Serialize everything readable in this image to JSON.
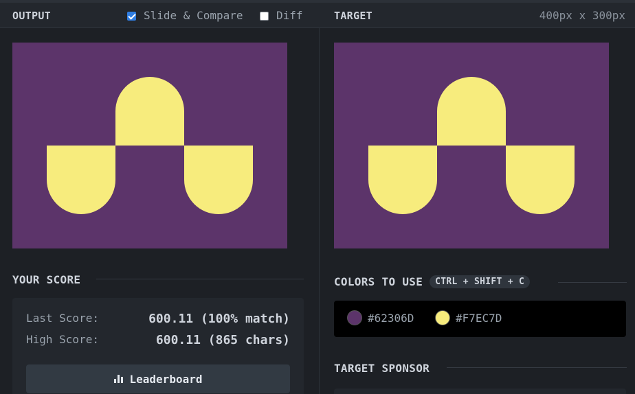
{
  "header": {
    "output_label": "OUTPUT",
    "slide_compare_label": "Slide & Compare",
    "slide_compare_checked": true,
    "diff_label": "Diff",
    "diff_checked": false,
    "target_label": "TARGET",
    "dimensions": "400px x 300px"
  },
  "score": {
    "title": "YOUR SCORE",
    "last_label": "Last Score:",
    "last_value": "600.11 (100% match)",
    "high_label": "High Score:",
    "high_value": "600.11 (865 chars)",
    "leaderboard_label": "Leaderboard"
  },
  "colors": {
    "title": "COLORS TO USE",
    "shortcut": "CTRL + SHIFT + C",
    "swatches": [
      {
        "label": "#62306D",
        "color": "#5c346a"
      },
      {
        "label": "#F7EC7D",
        "color": "#f7ec7d"
      }
    ]
  },
  "sponsor": {
    "title": "TARGET SPONSOR"
  },
  "canvas": {
    "background": "#5c346a",
    "shape_color": "#f7ec7d"
  }
}
